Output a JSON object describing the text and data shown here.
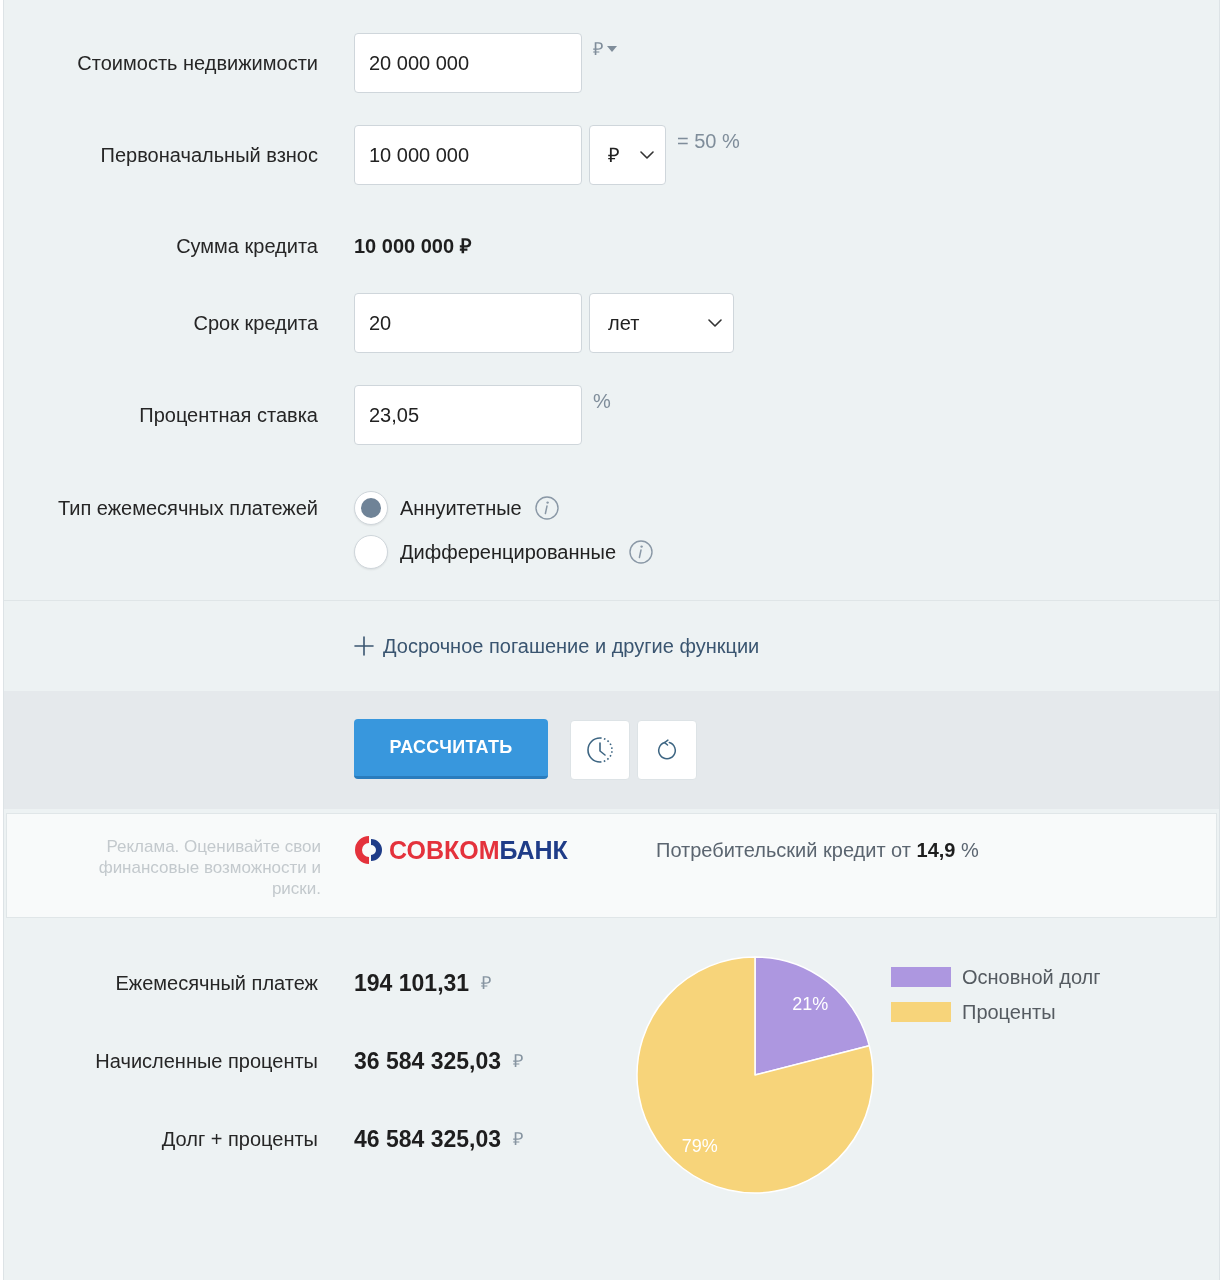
{
  "form": {
    "rows": [
      {
        "kind": "unit_menu",
        "label": "Стоимость недвижимости",
        "value": "20 000 000",
        "unit": "₽"
      },
      {
        "kind": "select",
        "label": "Первоначальный взнос",
        "value": "10 000 000",
        "select": "₽",
        "note": "= 50 %"
      },
      {
        "kind": "readout",
        "label": "Сумма кредита",
        "value": "10 000 000 ₽"
      },
      {
        "kind": "select_wide",
        "label": "Срок кредита",
        "value": "20",
        "select": "лет"
      },
      {
        "kind": "unit",
        "label": "Процентная ставка",
        "value": "23,05",
        "unit": "%"
      },
      {
        "kind": "radio",
        "label": "Тип ежемесячных платежей",
        "options": [
          {
            "label": "Аннуитетные",
            "selected": true
          },
          {
            "label": "Дифференцированные",
            "selected": false
          }
        ]
      }
    ]
  },
  "more_link": {
    "label": "Досрочное погашение и другие функции"
  },
  "actions": {
    "calculate": "РАССЧИТАТЬ"
  },
  "ad": {
    "disclaimer": "Реклама. Оценивайте свои финансовые возможности и риски.",
    "logo": [
      "СОВКОМ",
      "БАНК"
    ],
    "offer": "Потребительский кредит от **14,9** %"
  },
  "results": {
    "rows": [
      {
        "label": "Ежемесячный платеж",
        "value": "194 101,31",
        "currency": "₽"
      },
      {
        "label": "Начисленные проценты",
        "value": "36 584 325,03",
        "currency": "₽"
      },
      {
        "label": "Долг + проценты",
        "value": "46 584 325,03",
        "currency": "₽"
      }
    ],
    "chart_data": {
      "type": "pie",
      "categories": [
        "Основной долг",
        "Проценты"
      ],
      "values": [
        21,
        79
      ],
      "colors": [
        "#ad97e0",
        "#f7d47a"
      ],
      "value_labels": [
        "21%",
        "79%"
      ],
      "legend": "right"
    }
  }
}
